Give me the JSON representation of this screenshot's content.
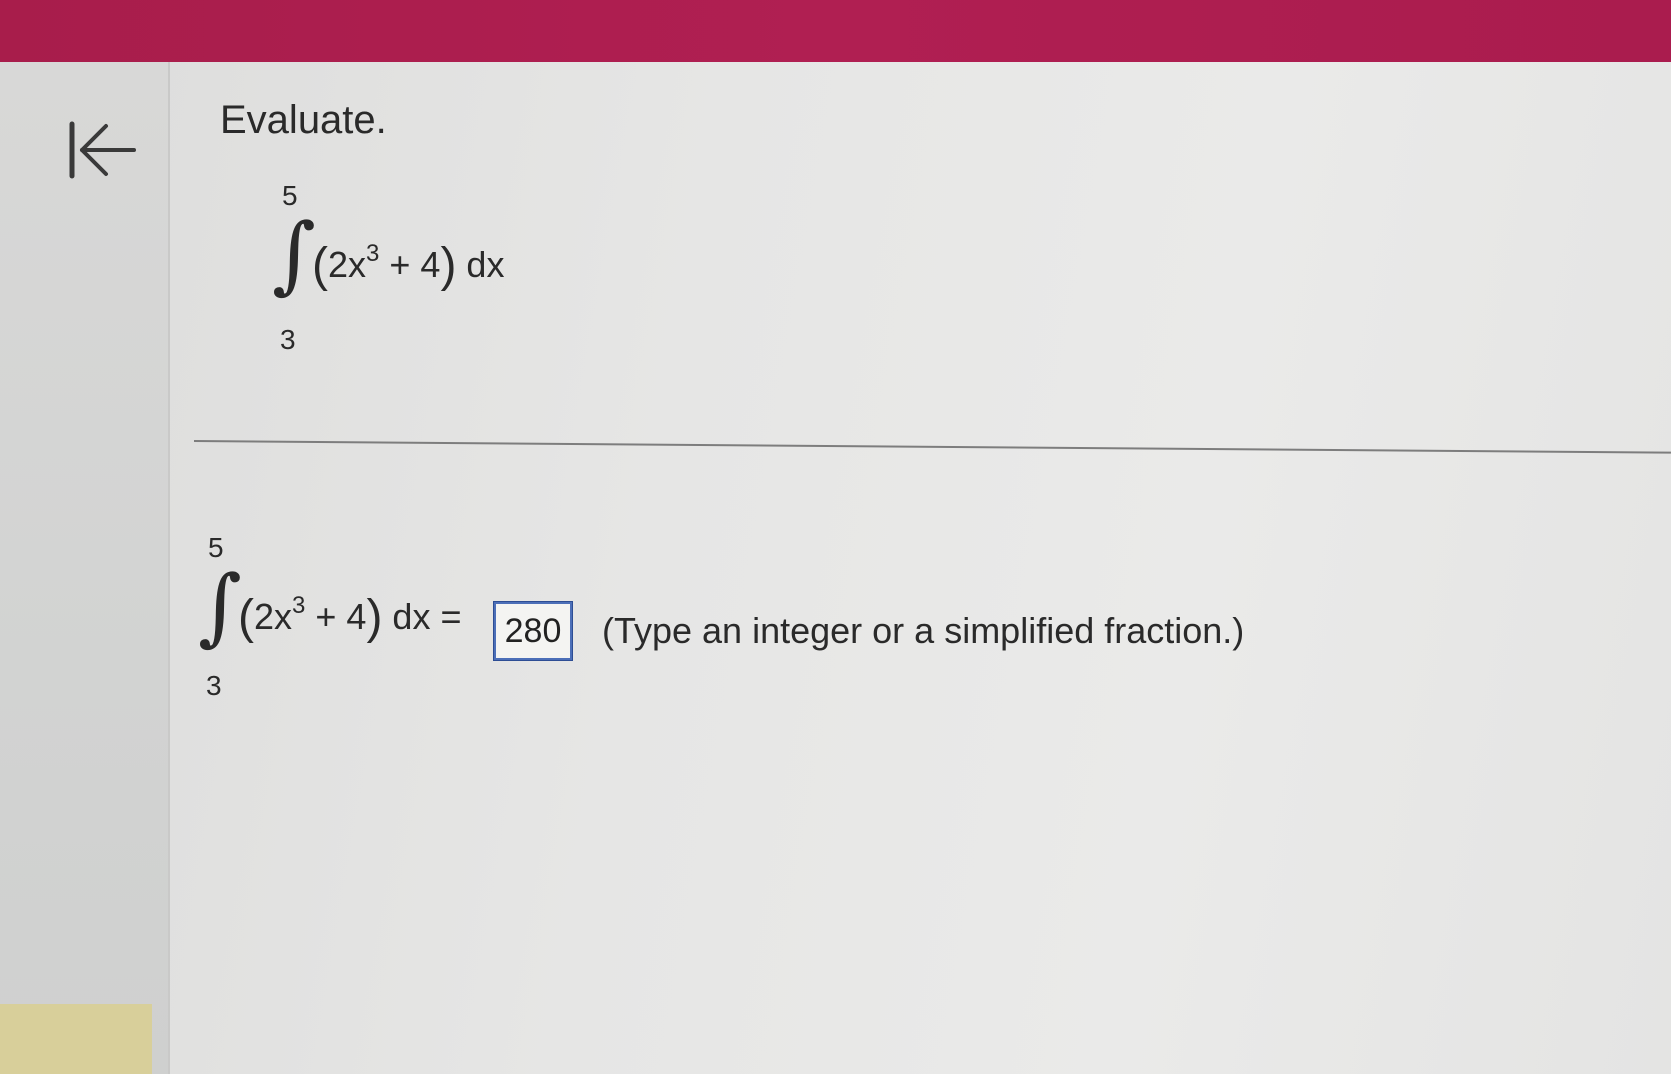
{
  "header": {
    "accent_color": "#ab1d4e"
  },
  "nav": {
    "back_icon": "first-page-arrow-icon"
  },
  "question": {
    "prompt": "Evaluate.",
    "upper_limit": "5",
    "lower_limit": "3",
    "integrand_open": "(",
    "integrand_coef": "2x",
    "integrand_exp": "3",
    "integrand_rest": " + 4",
    "integrand_close": ")",
    "differential": " dx"
  },
  "answer": {
    "equals": " =",
    "value": "280",
    "hint": "(Type an integer or a simplified fraction.)"
  }
}
